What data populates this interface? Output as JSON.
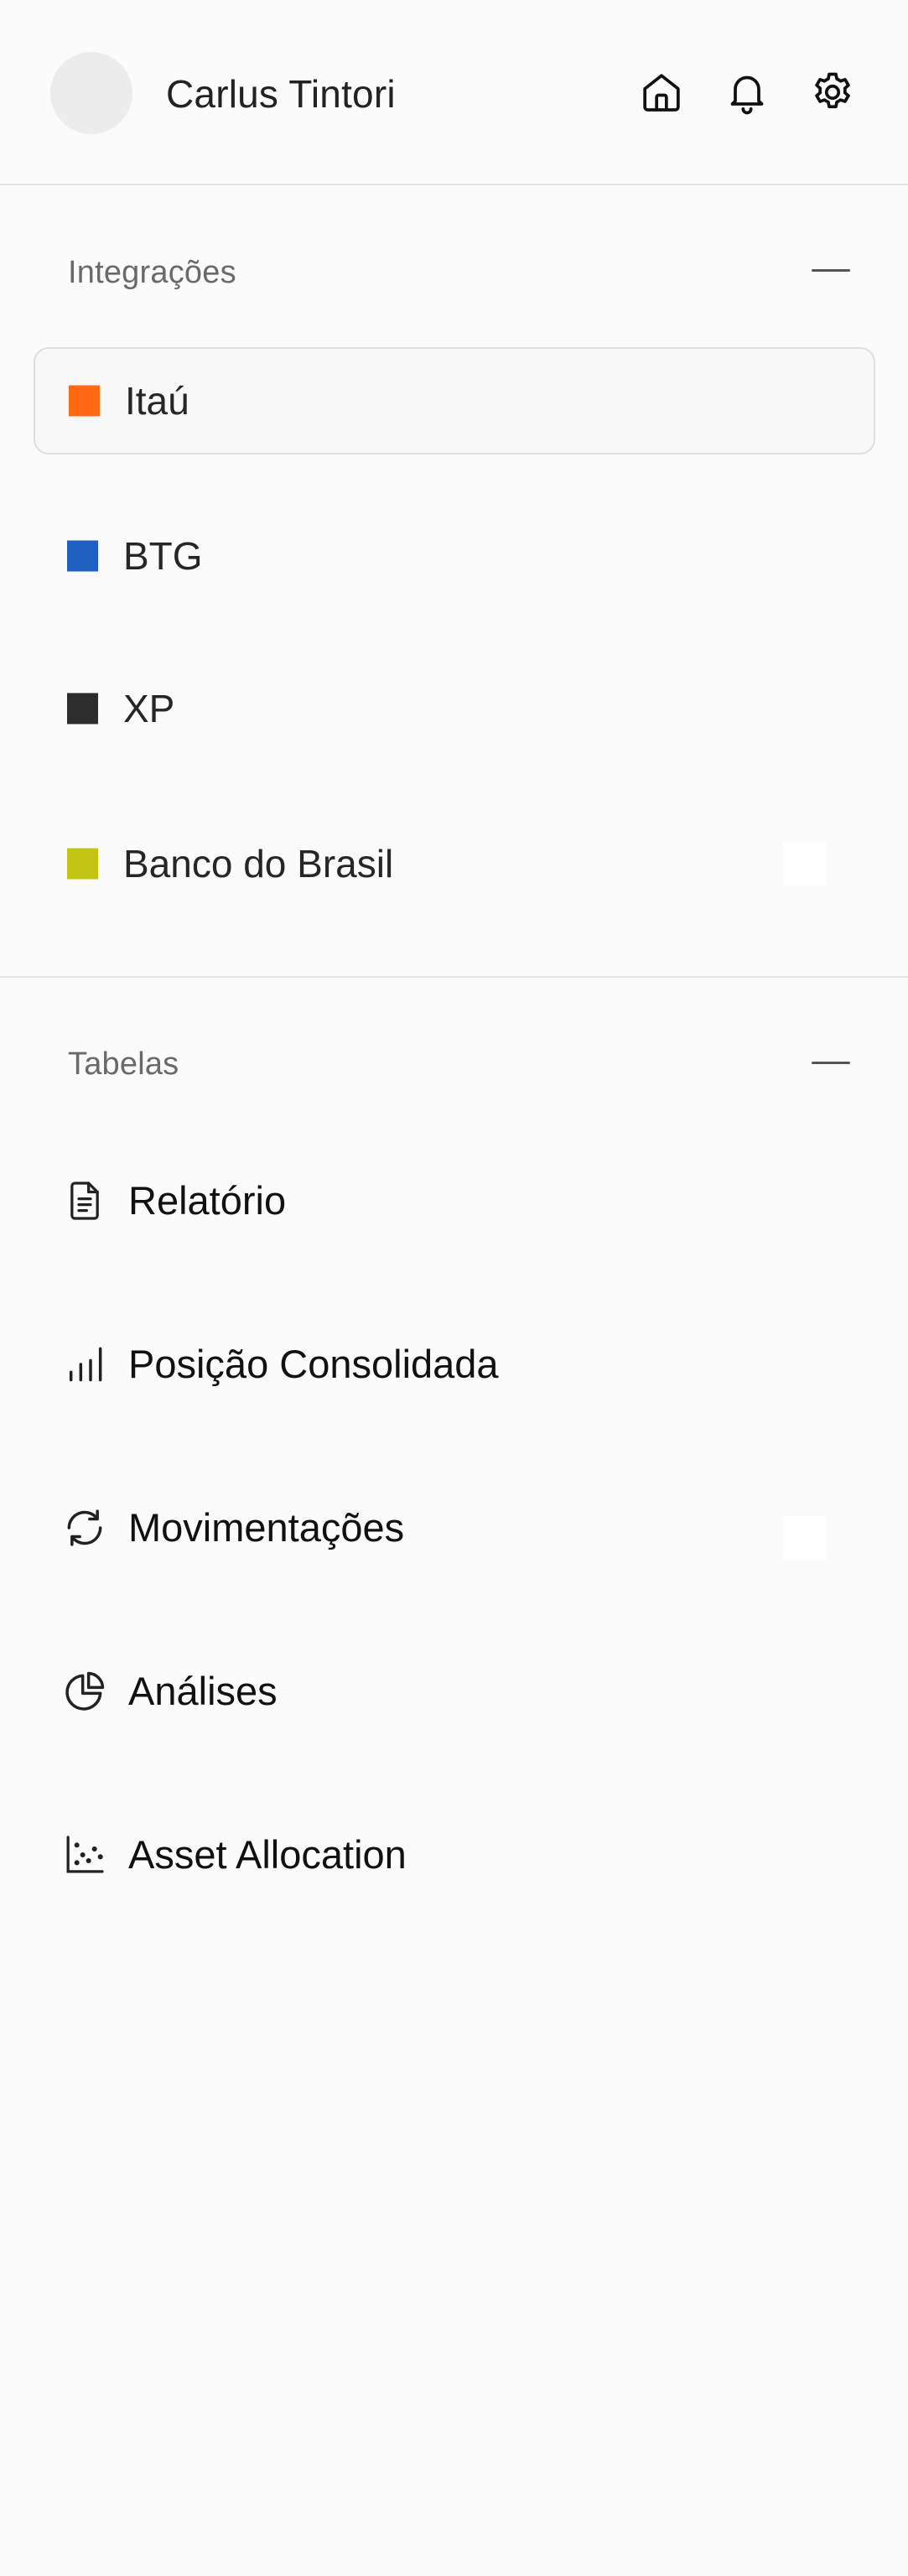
{
  "header": {
    "user_name": "Carlus Tintori",
    "icons": [
      "home-icon",
      "bell-icon",
      "gear-icon"
    ]
  },
  "integrations": {
    "title": "Integrações",
    "collapse_icon": "minus-icon",
    "items": [
      {
        "label": "Itaú",
        "color": "#ff6a13",
        "selected": true
      },
      {
        "label": "BTG",
        "color": "#1f5fbf",
        "selected": false
      },
      {
        "label": "XP",
        "color": "#2d2d2d",
        "selected": false
      },
      {
        "label": "Banco do Brasil",
        "color": "#c4c414",
        "selected": false
      }
    ]
  },
  "tables": {
    "title": "Tabelas",
    "collapse_icon": "minus-icon",
    "items": [
      {
        "label": "Relatório",
        "icon": "document-icon"
      },
      {
        "label": "Posição Consolidada",
        "icon": "bar-chart-icon"
      },
      {
        "label": "Movimentações",
        "icon": "refresh-icon"
      },
      {
        "label": "Análises",
        "icon": "pie-chart-icon"
      },
      {
        "label": "Asset Allocation",
        "icon": "scatter-chart-icon"
      }
    ]
  },
  "colors": {
    "background": "#fbfbfb",
    "divider": "#e3e3e3",
    "selected_border": "#dedede"
  }
}
